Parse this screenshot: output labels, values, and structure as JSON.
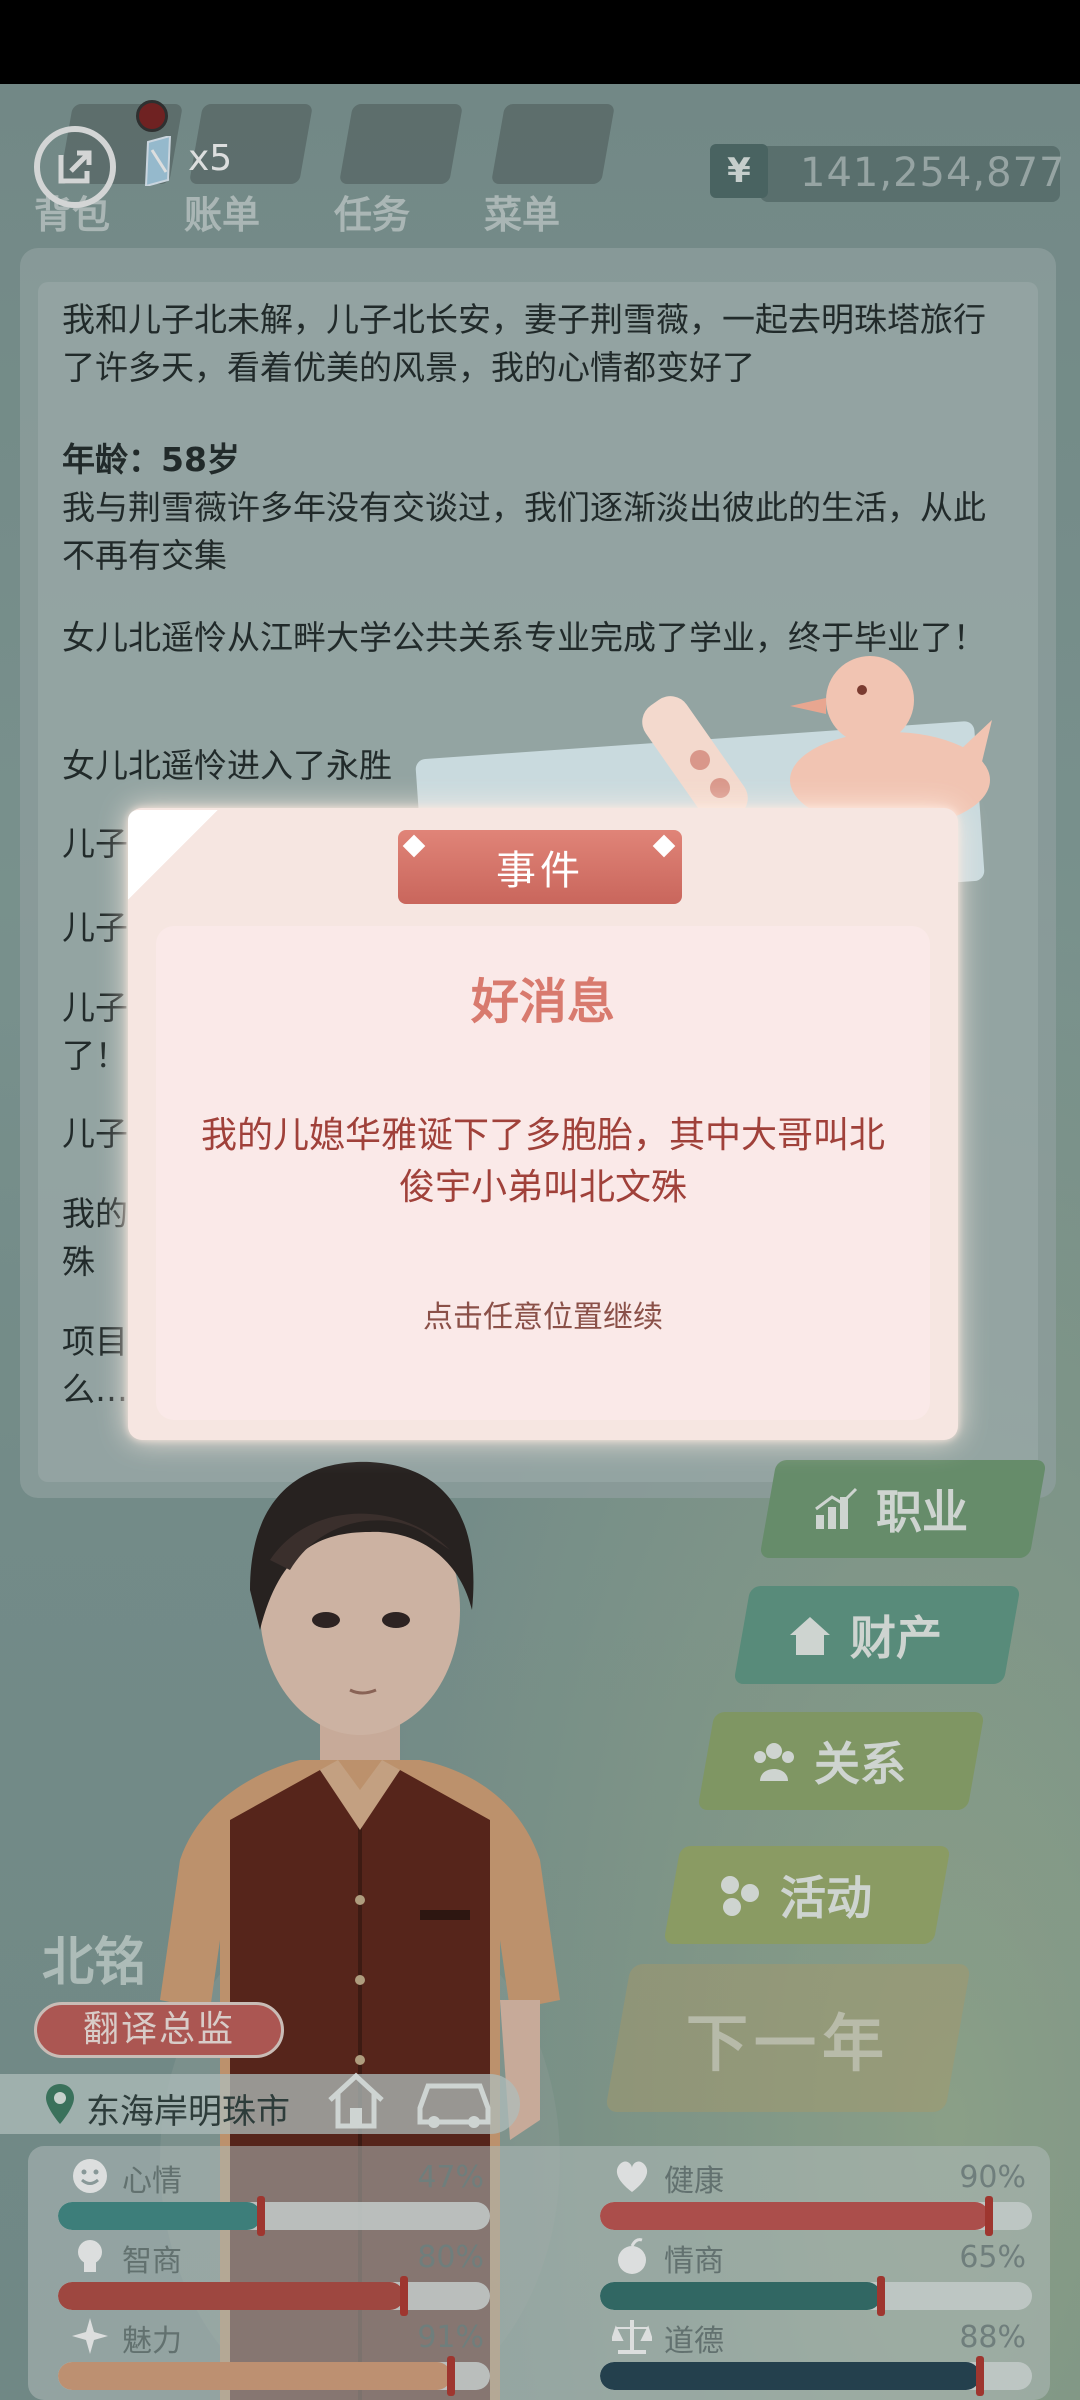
{
  "topbar": {
    "ticket_count": "x5",
    "tabs": [
      "背包",
      "账单",
      "任务",
      "菜单"
    ],
    "money_symbol": "¥",
    "money": "141,254,877"
  },
  "log": {
    "lines": [
      "我和儿子北未解，儿子北长安，妻子荆雪薇，一起去明珠塔旅行了许多天，看着优美的风景，我的心情都变好了",
      "我与荆雪薇许多年没有交谈过，我们逐渐淡出彼此的生活，从此不再有交集",
      "女儿北遥怜从江畔大学公共关系专业完成了学业，终于毕业了！",
      "女儿北遥怜进入了永胜",
      "儿子北",
      "儿子",
      "儿子",
      "了！",
      "儿子",
      "我的",
      "殊",
      "项目",
      "么…"
    ],
    "age_label": "年龄：",
    "age_value": "58岁"
  },
  "modal": {
    "tag": "事件",
    "heading": "好消息",
    "message": "我的儿媳华雅诞下了多胞胎，其中大哥叫北俊宇小弟叫北文殊",
    "hint": "点击任意位置继续"
  },
  "menu": {
    "career": "职业",
    "assets": "财产",
    "relations": "关系",
    "activities": "活动",
    "next_year": "下一年"
  },
  "character": {
    "name": "北铭",
    "job": "翻译总监",
    "location": "东海岸明珠市"
  },
  "stats": [
    {
      "label": "心情",
      "pct": "47%",
      "value": 0.47,
      "icon": "smile-icon",
      "color": "#3e8a86"
    },
    {
      "label": "健康",
      "pct": "90%",
      "value": 0.9,
      "icon": "heart-icon",
      "color": "#c4504c"
    },
    {
      "label": "智商",
      "pct": "80%",
      "value": 0.8,
      "icon": "bulb-icon",
      "color": "#b4473f"
    },
    {
      "label": "情商",
      "pct": "65%",
      "value": 0.65,
      "icon": "apple-icon",
      "color": "#2f6e6a"
    },
    {
      "label": "魅力",
      "pct": "91%",
      "value": 0.91,
      "icon": "sparkle-icon",
      "color": "#d9a07a"
    },
    {
      "label": "道德",
      "pct": "88%",
      "value": 0.88,
      "icon": "scales-icon",
      "color": "#1f3f4f"
    }
  ]
}
